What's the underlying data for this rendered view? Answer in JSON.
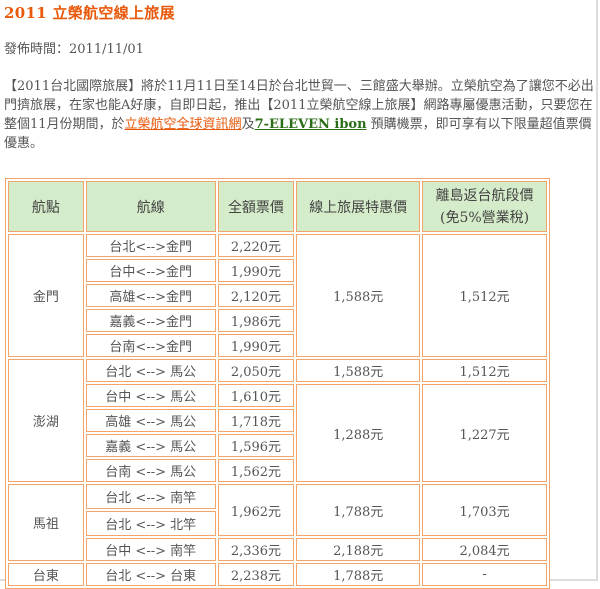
{
  "title": "2011 立榮航空線上旅展",
  "date_line": "發佈時間：2011/11/01",
  "paragraph": {
    "part1": "【2011台北國際旅展】將於11月11日至14日於台北世貿一、三館盛大舉辦。立榮航空為了讓您不必出門擠旅展，在家也能A好康，自即日起，推出【2011立榮航空線上旅展】網路專屬優惠活動，只要您在整個11月份期間，於",
    "link1": "立榮航空全球資訊網",
    "part2": "及",
    "link2": "7-ELEVEN ibon",
    "part3": " 預購機票，即可享有以下限量超值票價優惠。"
  },
  "table": {
    "headers": [
      "航點",
      "航線",
      "全額票價",
      "線上旅展特惠價",
      "離島返台航段價\n(免5%營業稅)"
    ],
    "kinmen": {
      "dest": "金門",
      "routes": [
        "台北<-->金門",
        "台中<-->金門",
        "高雄<-->金門",
        "嘉義<-->金門",
        "台南<-->金門"
      ],
      "fares": [
        "2,220元",
        "1,990元",
        "2,120元",
        "1,986元",
        "1,990元"
      ],
      "special": "1,588元",
      "island": "1,512元"
    },
    "penghu": {
      "dest": "澎湖",
      "routes": [
        "台北 <--> 馬公",
        "台中 <--> 馬公",
        "高雄 <--> 馬公",
        "嘉義 <--> 馬公",
        "台南 <--> 馬公"
      ],
      "fares": [
        "2,050元",
        "1,610元",
        "1,718元",
        "1,596元",
        "1,562元"
      ],
      "special_first": "1,588元",
      "island_first": "1,512元",
      "special_rest": "1,288元",
      "island_rest": "1,227元"
    },
    "matsu": {
      "dest": "馬祖",
      "routes": [
        "台北 <--> 南竿",
        "台北 <--> 北竿",
        "台中 <--> 南竿"
      ],
      "fare_taipei": "1,962元",
      "fare_taichung": "2,336元",
      "special_taipei": "1,788元",
      "island_taipei": "1,703元",
      "special_taichung": "2,188元",
      "island_taichung": "2,084元"
    },
    "taitung": {
      "dest": "台東",
      "route": "台北 <--> 台東",
      "fare": "2,238元",
      "special": "1,788元",
      "island": "-"
    }
  }
}
